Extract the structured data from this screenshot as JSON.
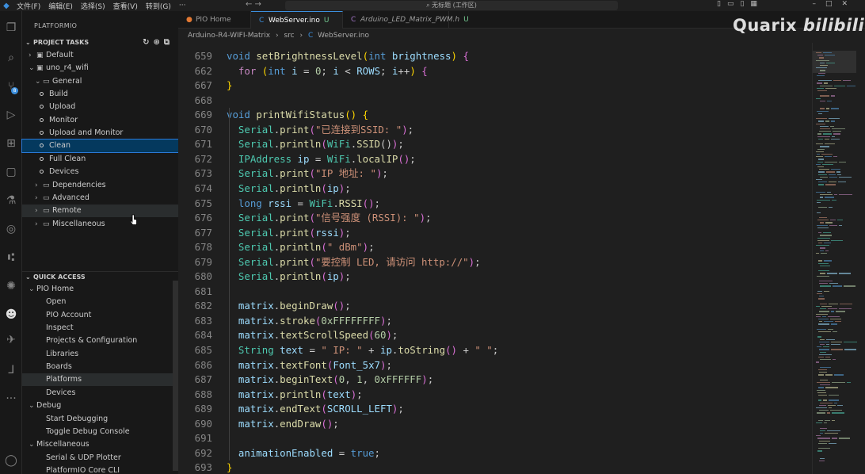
{
  "titlebar": {
    "menus": [
      "文件(F)",
      "编辑(E)",
      "选择(S)",
      "查看(V)",
      "转到(G)",
      "···"
    ],
    "nav_arrows": "←  →",
    "search_text": "无标题 (工作区)"
  },
  "activity_icons": [
    "files-icon",
    "search-icon",
    "source-control-icon",
    "run-debug-icon",
    "extensions-icon",
    "remote-explorer-icon",
    "testing-icon",
    "copilot-icon",
    "git-graph-icon",
    "platformio-icon",
    "alien-icon",
    "espidf-icon",
    "pio-project-icon",
    "more-icon",
    "account-icon"
  ],
  "source_control_badge": "8",
  "sidebar": {
    "title": "PLATFORMIO",
    "project_tasks": {
      "title": "PROJECT TASKS",
      "rows": [
        {
          "label": "Default",
          "level": 1,
          "chev": "›",
          "icon": "▣",
          "kind": "folder"
        },
        {
          "label": "uno_r4_wifi",
          "level": 1,
          "chev": "⌄",
          "icon": "▣",
          "kind": "folder"
        },
        {
          "label": "General",
          "level": 2,
          "chev": "⌄",
          "icon": "▭",
          "kind": "folder"
        },
        {
          "label": "Build",
          "level": 3,
          "kind": "task"
        },
        {
          "label": "Upload",
          "level": 3,
          "kind": "task"
        },
        {
          "label": "Monitor",
          "level": 3,
          "kind": "task"
        },
        {
          "label": "Upload and Monitor",
          "level": 3,
          "kind": "task"
        },
        {
          "label": "Clean",
          "level": 3,
          "kind": "task",
          "selected": true
        },
        {
          "label": "Full Clean",
          "level": 3,
          "kind": "task"
        },
        {
          "label": "Devices",
          "level": 3,
          "kind": "task"
        },
        {
          "label": "Dependencies",
          "level": 2,
          "chev": "›",
          "icon": "▭",
          "kind": "folder"
        },
        {
          "label": "Advanced",
          "level": 2,
          "chev": "›",
          "icon": "▭",
          "kind": "folder"
        },
        {
          "label": "Remote",
          "level": 2,
          "chev": "›",
          "icon": "▭",
          "kind": "folder",
          "hover": true
        },
        {
          "label": "Miscellaneous",
          "level": 2,
          "chev": "›",
          "icon": "▭",
          "kind": "folder"
        }
      ]
    },
    "quick_access": {
      "title": "QUICK ACCESS",
      "rows": [
        {
          "label": "PIO Home",
          "level": 1,
          "chev": "⌄"
        },
        {
          "label": "Open",
          "level": 2
        },
        {
          "label": "PIO Account",
          "level": 2
        },
        {
          "label": "Inspect",
          "level": 2
        },
        {
          "label": "Projects & Configuration",
          "level": 2
        },
        {
          "label": "Libraries",
          "level": 2
        },
        {
          "label": "Boards",
          "level": 2
        },
        {
          "label": "Platforms",
          "level": 2,
          "hover": true
        },
        {
          "label": "Devices",
          "level": 2
        },
        {
          "label": "Debug",
          "level": 1,
          "chev": "⌄"
        },
        {
          "label": "Start Debugging",
          "level": 2
        },
        {
          "label": "Toggle Debug Console",
          "level": 2
        },
        {
          "label": "Miscellaneous",
          "level": 1,
          "chev": "⌄"
        },
        {
          "label": "Serial & UDP Plotter",
          "level": 2
        },
        {
          "label": "PlatformIO Core CLI",
          "level": 2
        }
      ]
    }
  },
  "tabs": [
    {
      "label": "PIO Home",
      "icon": "●",
      "icon_color": "#e37933",
      "modified": "",
      "active": false,
      "italic": false
    },
    {
      "label": "WebServer.ino",
      "icon": "C",
      "icon_color": "#3c8fdd",
      "modified": "U",
      "active": true,
      "italic": false
    },
    {
      "label": "Arduino_LED_Matrix_PWM.h",
      "icon": "C",
      "icon_color": "#a074c4",
      "modified": "U",
      "active": false,
      "italic": true
    }
  ],
  "breadcrumb": {
    "parts": [
      "Arduino-R4-WIFI-Matrix",
      "src",
      "WebServer.ino"
    ],
    "sep": "›",
    "file_icon": "C"
  },
  "code_lines": [
    {
      "n": "659",
      "t": [
        [
          "void ",
          "kw"
        ],
        [
          "setBrightnessLevel",
          "fn"
        ],
        [
          "(",
          "brk"
        ],
        [
          "int ",
          "kw"
        ],
        [
          "brightness",
          "var"
        ],
        [
          ") ",
          "brk"
        ],
        [
          "{",
          "brk2"
        ]
      ]
    },
    {
      "n": "662",
      "t": [
        [
          "  ",
          ""
        ],
        [
          "for ",
          "ctl"
        ],
        [
          "(",
          "brk"
        ],
        [
          "int ",
          "kw"
        ],
        [
          "i",
          "var"
        ],
        [
          " = ",
          ""
        ],
        [
          "0",
          "num"
        ],
        [
          "; ",
          ""
        ],
        [
          "i",
          "var"
        ],
        [
          " < ",
          ""
        ],
        [
          "ROWS",
          "var"
        ],
        [
          "; ",
          ""
        ],
        [
          "i",
          "var"
        ],
        [
          "++",
          ""
        ],
        [
          ") ",
          "brk"
        ],
        [
          "{",
          "brk2"
        ]
      ]
    },
    {
      "n": "667",
      "t": [
        [
          "}",
          "brk"
        ]
      ]
    },
    {
      "n": "668",
      "t": []
    },
    {
      "n": "669",
      "t": [
        [
          "void ",
          "kw"
        ],
        [
          "printWifiStatus",
          "fn"
        ],
        [
          "() ",
          "brk"
        ],
        [
          "{",
          "brk"
        ]
      ]
    },
    {
      "n": "670",
      "t": [
        [
          "  ",
          ""
        ],
        [
          "Serial",
          "ty"
        ],
        [
          ".",
          ""
        ],
        [
          "print",
          "fn"
        ],
        [
          "(",
          "brk2"
        ],
        [
          "\"已连接到SSID: \"",
          "str"
        ],
        [
          ")",
          "brk2"
        ],
        [
          ";",
          ""
        ]
      ]
    },
    {
      "n": "671",
      "t": [
        [
          "  ",
          ""
        ],
        [
          "Serial",
          "ty"
        ],
        [
          ".",
          ""
        ],
        [
          "println",
          "fn"
        ],
        [
          "(",
          "brk2"
        ],
        [
          "WiFi",
          "ty"
        ],
        [
          ".",
          ""
        ],
        [
          "SSID",
          "fn"
        ],
        [
          "()",
          ""
        ],
        [
          ")",
          "brk2"
        ],
        [
          ";",
          ""
        ]
      ]
    },
    {
      "n": "672",
      "t": [
        [
          "  ",
          ""
        ],
        [
          "IPAddress ",
          "ty"
        ],
        [
          "ip",
          "var"
        ],
        [
          " = ",
          ""
        ],
        [
          "WiFi",
          "ty"
        ],
        [
          ".",
          ""
        ],
        [
          "localIP",
          "fn"
        ],
        [
          "()",
          "brk2"
        ],
        [
          ";",
          ""
        ]
      ]
    },
    {
      "n": "673",
      "t": [
        [
          "  ",
          ""
        ],
        [
          "Serial",
          "ty"
        ],
        [
          ".",
          ""
        ],
        [
          "print",
          "fn"
        ],
        [
          "(",
          "brk2"
        ],
        [
          "\"IP 地址: \"",
          "str"
        ],
        [
          ")",
          "brk2"
        ],
        [
          ";",
          ""
        ]
      ]
    },
    {
      "n": "674",
      "t": [
        [
          "  ",
          ""
        ],
        [
          "Serial",
          "ty"
        ],
        [
          ".",
          ""
        ],
        [
          "println",
          "fn"
        ],
        [
          "(",
          "brk2"
        ],
        [
          "ip",
          "var"
        ],
        [
          ")",
          "brk2"
        ],
        [
          ";",
          ""
        ]
      ]
    },
    {
      "n": "675",
      "t": [
        [
          "  ",
          ""
        ],
        [
          "long ",
          "kw"
        ],
        [
          "rssi",
          "var"
        ],
        [
          " = ",
          ""
        ],
        [
          "WiFi",
          "ty"
        ],
        [
          ".",
          ""
        ],
        [
          "RSSI",
          "fn"
        ],
        [
          "()",
          "brk2"
        ],
        [
          ";",
          ""
        ]
      ]
    },
    {
      "n": "676",
      "t": [
        [
          "  ",
          ""
        ],
        [
          "Serial",
          "ty"
        ],
        [
          ".",
          ""
        ],
        [
          "print",
          "fn"
        ],
        [
          "(",
          "brk2"
        ],
        [
          "\"信号强度 (RSSI): \"",
          "str"
        ],
        [
          ")",
          "brk2"
        ],
        [
          ";",
          ""
        ]
      ]
    },
    {
      "n": "677",
      "t": [
        [
          "  ",
          ""
        ],
        [
          "Serial",
          "ty"
        ],
        [
          ".",
          ""
        ],
        [
          "print",
          "fn"
        ],
        [
          "(",
          "brk2"
        ],
        [
          "rssi",
          "var"
        ],
        [
          ")",
          "brk2"
        ],
        [
          ";",
          ""
        ]
      ]
    },
    {
      "n": "678",
      "t": [
        [
          "  ",
          ""
        ],
        [
          "Serial",
          "ty"
        ],
        [
          ".",
          ""
        ],
        [
          "println",
          "fn"
        ],
        [
          "(",
          "brk2"
        ],
        [
          "\" dBm\"",
          "str"
        ],
        [
          ")",
          "brk2"
        ],
        [
          ";",
          ""
        ]
      ]
    },
    {
      "n": "679",
      "t": [
        [
          "  ",
          ""
        ],
        [
          "Serial",
          "ty"
        ],
        [
          ".",
          ""
        ],
        [
          "print",
          "fn"
        ],
        [
          "(",
          "brk2"
        ],
        [
          "\"要控制 LED, 请访问 http://\"",
          "str"
        ],
        [
          ")",
          "brk2"
        ],
        [
          ";",
          ""
        ]
      ]
    },
    {
      "n": "680",
      "t": [
        [
          "  ",
          ""
        ],
        [
          "Serial",
          "ty"
        ],
        [
          ".",
          ""
        ],
        [
          "println",
          "fn"
        ],
        [
          "(",
          "brk2"
        ],
        [
          "ip",
          "var"
        ],
        [
          ")",
          "brk2"
        ],
        [
          ";",
          ""
        ]
      ]
    },
    {
      "n": "681",
      "t": []
    },
    {
      "n": "682",
      "t": [
        [
          "  ",
          ""
        ],
        [
          "matrix",
          "var"
        ],
        [
          ".",
          ""
        ],
        [
          "beginDraw",
          "fn"
        ],
        [
          "()",
          "brk2"
        ],
        [
          ";",
          ""
        ]
      ]
    },
    {
      "n": "683",
      "t": [
        [
          "  ",
          ""
        ],
        [
          "matrix",
          "var"
        ],
        [
          ".",
          ""
        ],
        [
          "stroke",
          "fn"
        ],
        [
          "(",
          "brk2"
        ],
        [
          "0xFFFFFFFF",
          "num"
        ],
        [
          ")",
          "brk2"
        ],
        [
          ";",
          ""
        ]
      ]
    },
    {
      "n": "684",
      "t": [
        [
          "  ",
          ""
        ],
        [
          "matrix",
          "var"
        ],
        [
          ".",
          ""
        ],
        [
          "textScrollSpeed",
          "fn"
        ],
        [
          "(",
          "brk2"
        ],
        [
          "60",
          "num"
        ],
        [
          ")",
          "brk2"
        ],
        [
          ";",
          ""
        ]
      ]
    },
    {
      "n": "685",
      "t": [
        [
          "  ",
          ""
        ],
        [
          "String ",
          "ty"
        ],
        [
          "text",
          "var"
        ],
        [
          " = ",
          ""
        ],
        [
          "\" IP: \"",
          "str"
        ],
        [
          " + ",
          ""
        ],
        [
          "ip",
          "var"
        ],
        [
          ".",
          ""
        ],
        [
          "toString",
          "fn"
        ],
        [
          "()",
          "brk2"
        ],
        [
          " + ",
          ""
        ],
        [
          "\" \"",
          "str"
        ],
        [
          ";",
          ""
        ]
      ]
    },
    {
      "n": "686",
      "t": [
        [
          "  ",
          ""
        ],
        [
          "matrix",
          "var"
        ],
        [
          ".",
          ""
        ],
        [
          "textFont",
          "fn"
        ],
        [
          "(",
          "brk2"
        ],
        [
          "Font_5x7",
          "var"
        ],
        [
          ")",
          "brk2"
        ],
        [
          ";",
          ""
        ]
      ]
    },
    {
      "n": "687",
      "t": [
        [
          "  ",
          ""
        ],
        [
          "matrix",
          "var"
        ],
        [
          ".",
          ""
        ],
        [
          "beginText",
          "fn"
        ],
        [
          "(",
          "brk2"
        ],
        [
          "0",
          "num"
        ],
        [
          ", ",
          ""
        ],
        [
          "1",
          "num"
        ],
        [
          ", ",
          ""
        ],
        [
          "0xFFFFFF",
          "num"
        ],
        [
          ")",
          "brk2"
        ],
        [
          ";",
          ""
        ]
      ]
    },
    {
      "n": "688",
      "t": [
        [
          "  ",
          ""
        ],
        [
          "matrix",
          "var"
        ],
        [
          ".",
          ""
        ],
        [
          "println",
          "fn"
        ],
        [
          "(",
          "brk2"
        ],
        [
          "text",
          "var"
        ],
        [
          ")",
          "brk2"
        ],
        [
          ";",
          ""
        ]
      ]
    },
    {
      "n": "689",
      "t": [
        [
          "  ",
          ""
        ],
        [
          "matrix",
          "var"
        ],
        [
          ".",
          ""
        ],
        [
          "endText",
          "fn"
        ],
        [
          "(",
          "brk2"
        ],
        [
          "SCROLL_LEFT",
          "var"
        ],
        [
          ")",
          "brk2"
        ],
        [
          ";",
          ""
        ]
      ]
    },
    {
      "n": "690",
      "t": [
        [
          "  ",
          ""
        ],
        [
          "matrix",
          "var"
        ],
        [
          ".",
          ""
        ],
        [
          "endDraw",
          "fn"
        ],
        [
          "()",
          "brk2"
        ],
        [
          ";",
          ""
        ]
      ]
    },
    {
      "n": "691",
      "t": []
    },
    {
      "n": "692",
      "t": [
        [
          "  ",
          ""
        ],
        [
          "animationEnabled",
          "var"
        ],
        [
          " = ",
          ""
        ],
        [
          "true",
          "kw"
        ],
        [
          ";",
          ""
        ]
      ]
    },
    {
      "n": "693",
      "t": [
        [
          "}",
          "brk"
        ]
      ]
    }
  ],
  "watermark": {
    "text": "Quarix",
    "logo": "bilibili"
  },
  "colors": {
    "accent": "#3c8fdd",
    "selection": "#04395e",
    "editor_bg": "#1f1f1f",
    "sidebar_bg": "#181818"
  }
}
